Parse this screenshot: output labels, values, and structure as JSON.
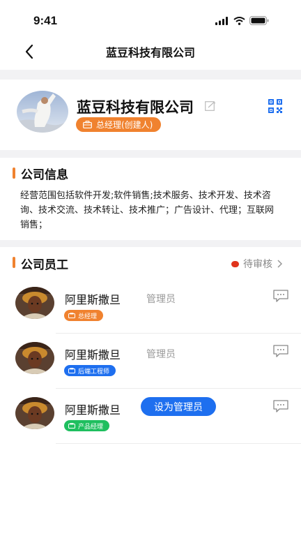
{
  "status": {
    "time": "9:41"
  },
  "nav": {
    "title": "蓝豆科技有限公司"
  },
  "company": {
    "name": "蓝豆科技有限公司",
    "role": "总经理(创建人)"
  },
  "info": {
    "title": "公司信息",
    "text": "经营范围包括软件开发;软件销售;技术服务、技术开发、技术咨询、技术交流、技术转让、技术推广；广告设计、代理；互联网销售；"
  },
  "staff": {
    "title": "公司员工",
    "pending_label": "待审核",
    "members": [
      {
        "name": "阿里斯撒旦",
        "role": "管理员",
        "tag": "总经理",
        "tag_color": "#f0822f"
      },
      {
        "name": "阿里斯撒旦",
        "role": "管理员",
        "tag": "后端工程师",
        "tag_color": "#1e6fef"
      },
      {
        "name": "阿里斯撒旦",
        "button": "设为管理员",
        "tag": "产品经理",
        "tag_color": "#1fbf5f"
      }
    ]
  },
  "colors": {
    "accent": "#f0822f",
    "primary": "#1e6fef",
    "green": "#1fbf5f",
    "pending_dot": "#e0341c"
  }
}
